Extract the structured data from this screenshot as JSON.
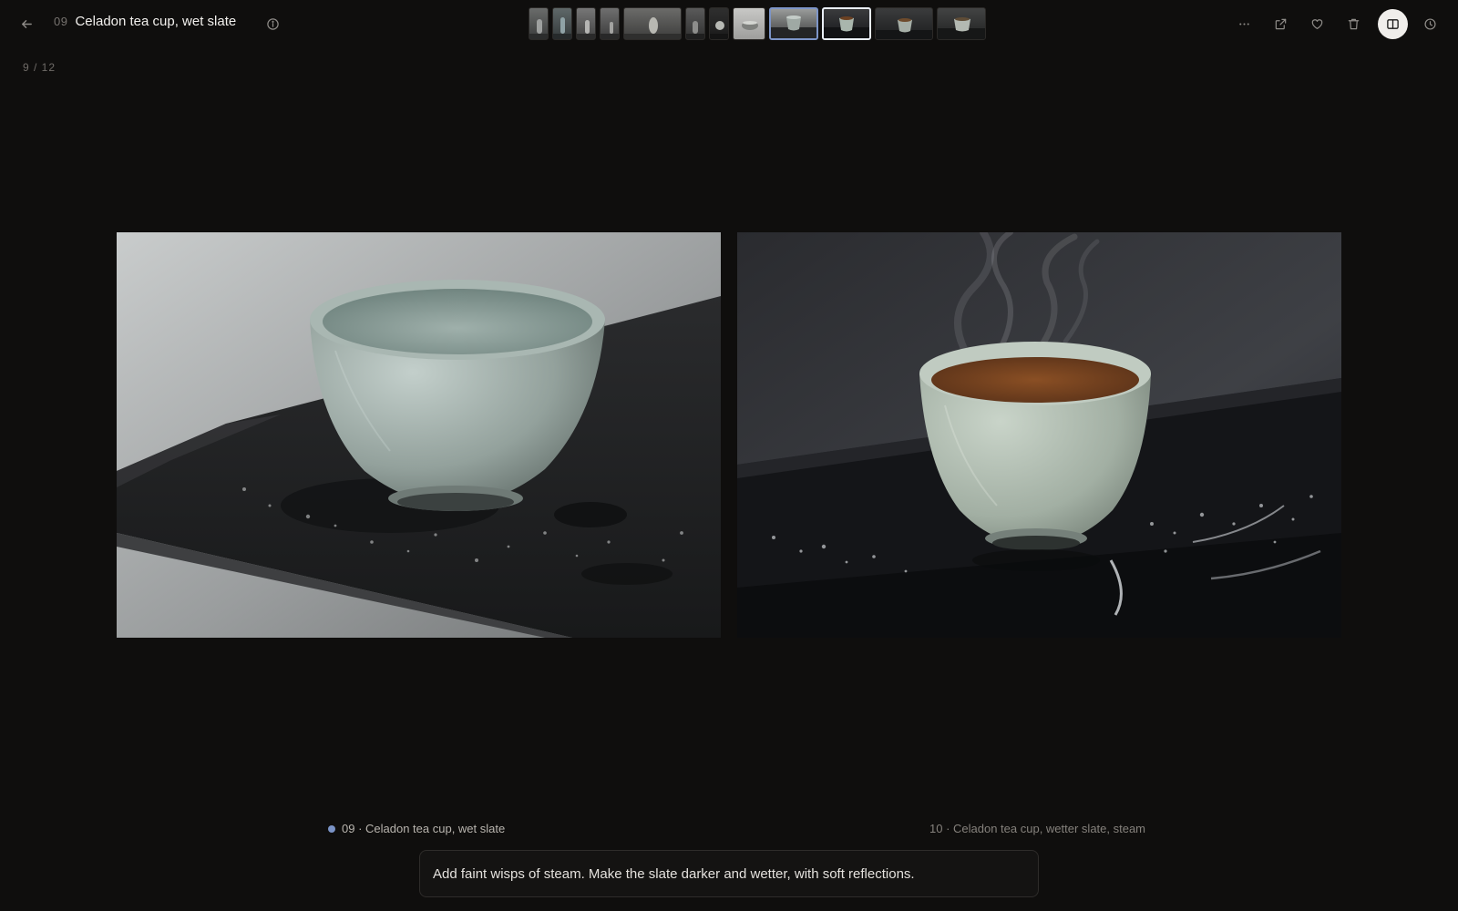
{
  "header": {
    "index": "09",
    "title": "Celadon tea cup, wet slate"
  },
  "viewer": {
    "counter": "9 / 12"
  },
  "filmstrip": {
    "count": 12,
    "active_index": 9,
    "compare_index": 10
  },
  "icons": {
    "back": "arrow-left-icon",
    "info": "info-icon",
    "more": "more-horizontal-icon",
    "share": "external-link-icon",
    "favorite": "heart-icon",
    "delete": "trash-icon",
    "compare": "split-view-icon",
    "history": "clock-icon"
  },
  "compare": {
    "left_caption": "09 · Celadon tea cup, wet slate",
    "right_caption": "10 · Celadon tea cup, wetter slate, steam"
  },
  "prompt": {
    "text": "Add faint wisps of steam. Make the slate darker and wetter, with soft reflections."
  },
  "colors": {
    "background": "#0f0e0d",
    "accent": "#7a93c6"
  }
}
